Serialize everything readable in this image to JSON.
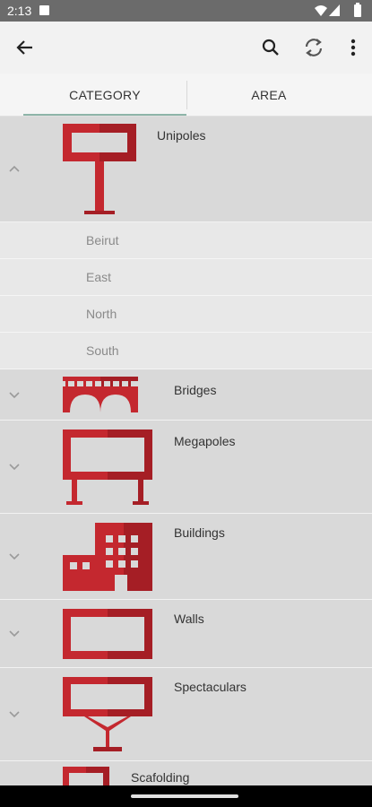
{
  "status_bar": {
    "time": "2:13"
  },
  "app_bar": {
    "icons": [
      "back-arrow-icon",
      "search-icon",
      "refresh-icon",
      "more-vert-icon"
    ]
  },
  "tabs": [
    {
      "label": "CATEGORY",
      "selected": true
    },
    {
      "label": "AREA",
      "selected": false
    }
  ],
  "categories": [
    {
      "label": "Unipoles",
      "expanded": true,
      "subitems": [
        "Beirut",
        "East",
        "North",
        "South"
      ]
    },
    {
      "label": "Bridges",
      "expanded": false
    },
    {
      "label": "Megapoles",
      "expanded": false
    },
    {
      "label": "Buildings",
      "expanded": false
    },
    {
      "label": "Walls",
      "expanded": false
    },
    {
      "label": "Spectaculars",
      "expanded": false
    },
    {
      "label": "Scafolding",
      "expanded": false
    }
  ],
  "colors": {
    "accent_red": "#c4282f",
    "accent_dark_red": "#a51e25",
    "tab_indicator": "#8db5a8"
  }
}
